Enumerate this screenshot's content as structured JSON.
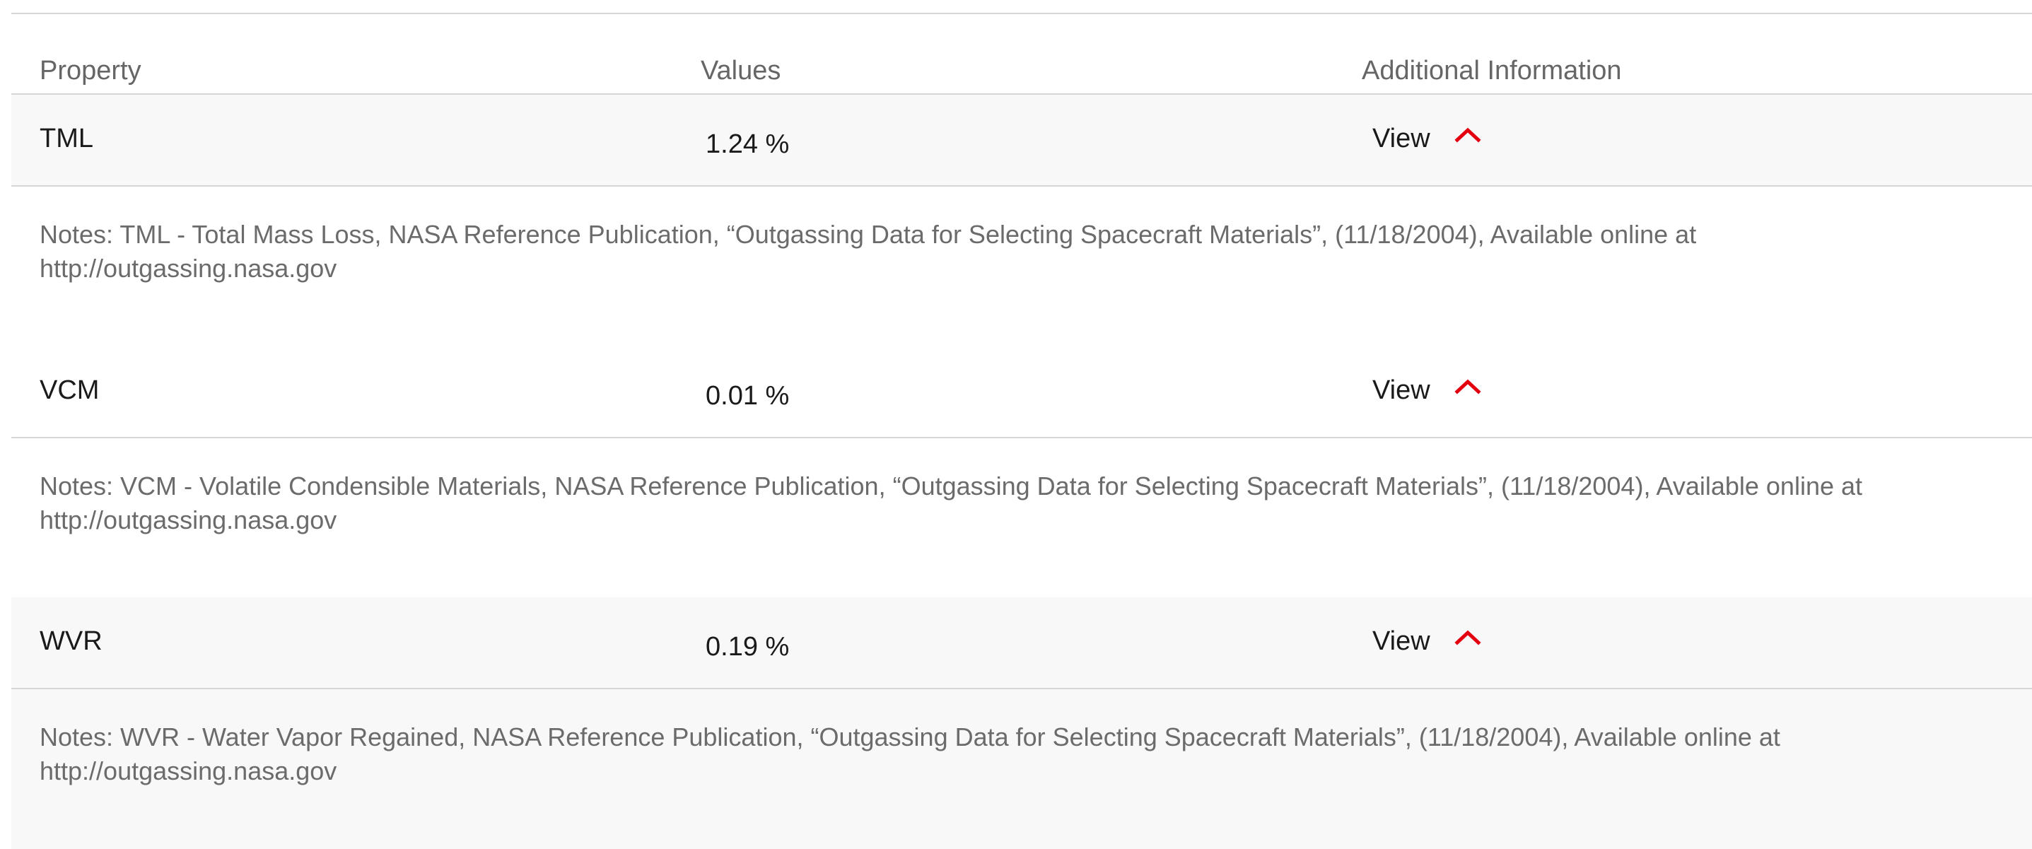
{
  "table": {
    "headers": {
      "property": "Property",
      "values": "Values",
      "additional": "Additional Information"
    },
    "rows": [
      {
        "property": "TML",
        "value": "1.24 %",
        "view_label": "View",
        "notes_line1": "Notes: TML - Total Mass Loss, NASA Reference Publication, “Outgassing Data for Selecting Spacecraft Materials”, (11/18/2004), Available online at",
        "notes_line2": "http://outgassing.nasa.gov"
      },
      {
        "property": "VCM",
        "value": "0.01 %",
        "view_label": "View",
        "notes_line1": "Notes: VCM - Volatile Condensible Materials, NASA Reference Publication, “Outgassing Data for Selecting Spacecraft Materials”, (11/18/2004), Available online at",
        "notes_line2": "http://outgassing.nasa.gov"
      },
      {
        "property": "WVR",
        "value": "0.19 %",
        "view_label": "View",
        "notes_line1": "Notes: WVR - Water Vapor Regained, NASA Reference Publication, “Outgassing Data for Selecting Spacecraft Materials”, (11/18/2004), Available online at",
        "notes_line2": "http://outgassing.nasa.gov"
      }
    ]
  },
  "icons": {
    "expand_toggle": "chevron-up-icon"
  },
  "colors": {
    "accent": "#e3000f",
    "shaded_row": "#f8f8f8",
    "divider": "#d6d6d6",
    "notes_text": "#6b6b6b"
  }
}
